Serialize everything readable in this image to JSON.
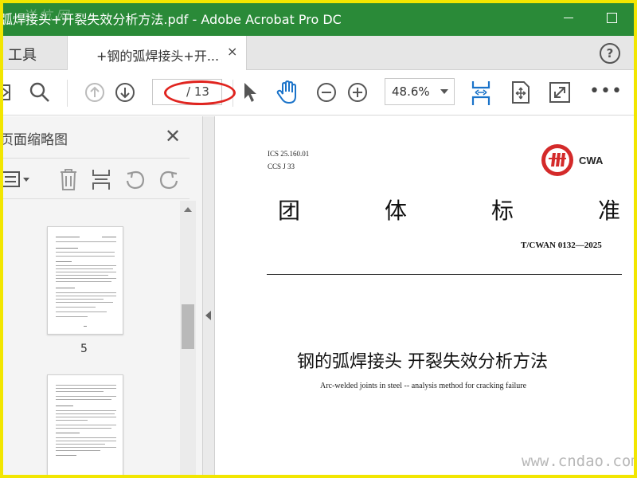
{
  "window": {
    "title": "弧焊接头+开裂失效分析方法.pdf - Adobe Acrobat Pro DC",
    "watermark_top": "详 抗 网"
  },
  "tabs": {
    "tools_label": "工具",
    "doc_tab_label": "+钢的弧焊接头+开...",
    "close_glyph": "×",
    "help_glyph": "?"
  },
  "toolbar": {
    "page_current": "",
    "page_total": "/ 13",
    "zoom": "48.6%",
    "more": "•••"
  },
  "colors": {
    "titlebar": "#2a8a38",
    "highlight_ellipse": "#e0241f",
    "frame": "#f2e600",
    "accent_blue": "#1a73c9"
  },
  "sidebar": {
    "title": "页面缩略图",
    "close_glyph": "✕",
    "thumbnails": [
      {
        "page_label": "5"
      },
      {
        "page_label": ""
      }
    ]
  },
  "document": {
    "ics": "ICS 25.160.01",
    "ccs": "CCS J 33",
    "logo_text": "CWA",
    "heading_chars": [
      "团",
      "体",
      "标",
      "准"
    ],
    "standard_number": "T/CWAN  0132—2025",
    "title_cn": "钢的弧焊接头  开裂失效分析方法",
    "title_en": "Arc-welded joints in steel -- analysis method for cracking failure"
  },
  "footer": {
    "watermark": "www.cndao.com"
  }
}
